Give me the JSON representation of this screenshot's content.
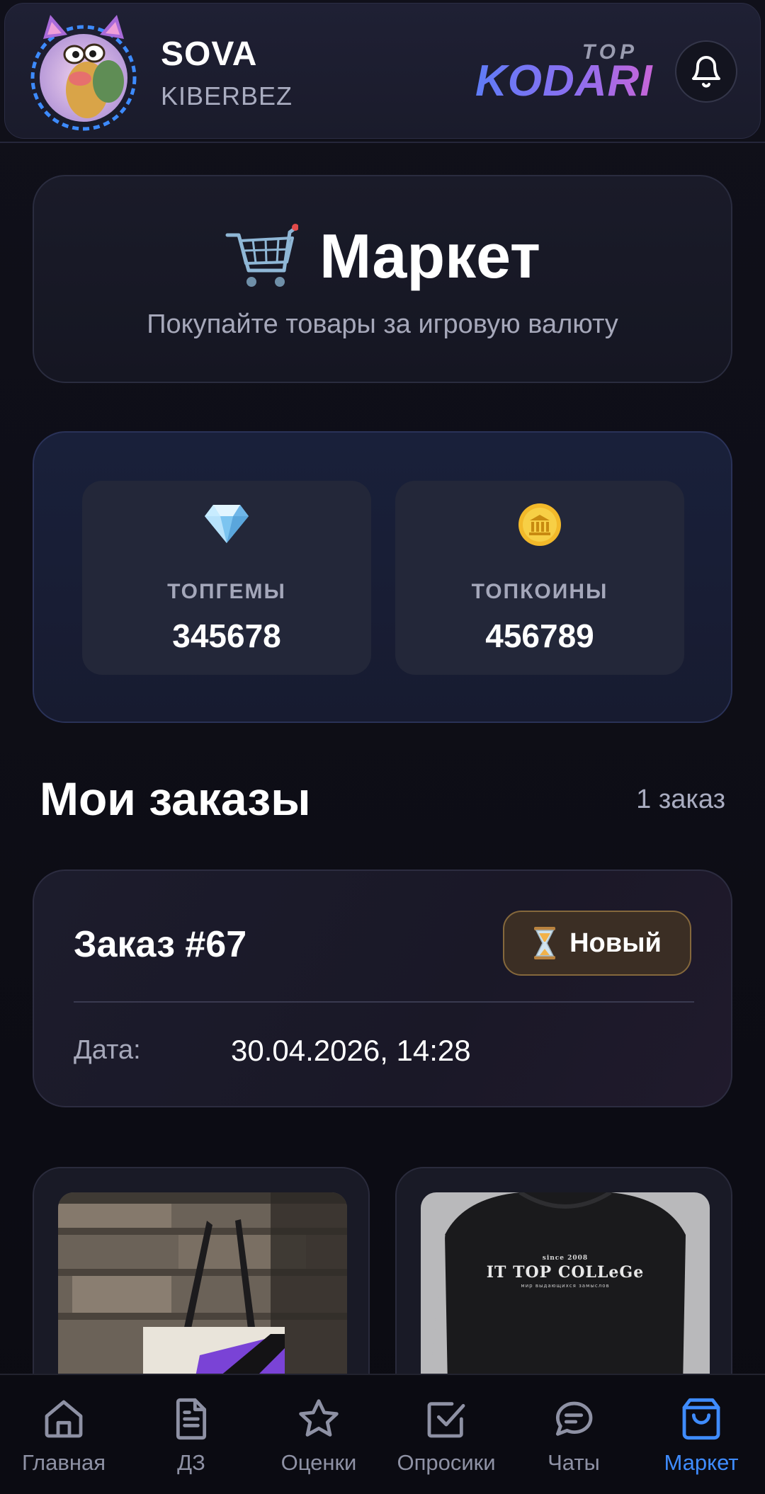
{
  "header": {
    "user_name": "SOVA",
    "user_group": "KIBERBEZ",
    "logo_top": "TOP",
    "logo_main": "KODARI"
  },
  "market": {
    "title": "Маркет",
    "subtitle": "Покупайте товары за игровую валюту"
  },
  "balance": {
    "gems_label": "ТОПГЕМЫ",
    "gems_value": "345678",
    "coins_label": "ТОПКОИНЫ",
    "coins_value": "456789"
  },
  "orders": {
    "title": "Мои заказы",
    "count": "1 заказ",
    "items": [
      {
        "number": "Заказ #67",
        "status": "Новый",
        "date_label": "Дата:",
        "date_value": "30.04.2026, 14:28"
      }
    ]
  },
  "products": [
    {
      "image": "tote-bag-photo"
    },
    {
      "image": "sweatshirt-photo",
      "print_title": "IT TOP COLLeGe",
      "print_since": "since 2008",
      "print_tagline": "мир выдающихся замыслов"
    }
  ],
  "nav": {
    "items": [
      {
        "label": "Главная",
        "icon": "home-icon"
      },
      {
        "label": "ДЗ",
        "icon": "document-icon"
      },
      {
        "label": "Оценки",
        "icon": "star-icon"
      },
      {
        "label": "Опросики",
        "icon": "checkbox-icon"
      },
      {
        "label": "Чаты",
        "icon": "chat-icon"
      },
      {
        "label": "Маркет",
        "icon": "bag-icon",
        "active": true
      }
    ]
  },
  "colors": {
    "accent": "#3f8cff",
    "background": "#0d0d14",
    "status_border": "#85683c"
  }
}
